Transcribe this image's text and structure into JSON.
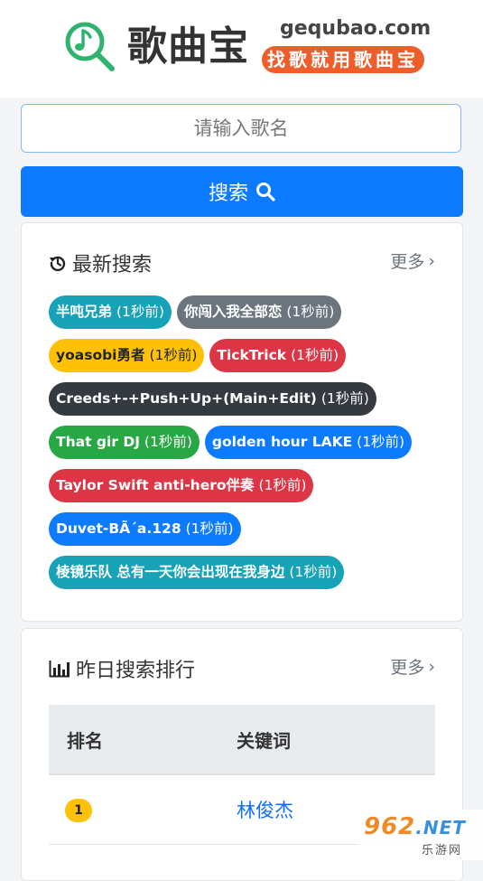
{
  "header": {
    "logo_name": "歌曲宝",
    "domain": "gequbao.com",
    "slogan": "找歌就用歌曲宝"
  },
  "search": {
    "placeholder": "请输入歌名",
    "button_label": "搜索"
  },
  "recent": {
    "title": "最新搜索",
    "more": "更多",
    "tags": [
      {
        "keyword": "半吨兄弟",
        "time": "(1秒前)",
        "color": "#17a2b8"
      },
      {
        "keyword": "你闯入我全部恋",
        "time": "(1秒前)",
        "color": "#6c757d"
      },
      {
        "keyword": "yoasobi勇者",
        "time": "(1秒前)",
        "color": "#ffc107"
      },
      {
        "keyword": "TickTrick",
        "time": "(1秒前)",
        "color": "#dc3545"
      },
      {
        "keyword": "Creeds+-+Push+Up+(Main+Edit)",
        "time": "(1秒前)",
        "color": "#343a40"
      },
      {
        "keyword": "That gir DJ",
        "time": "(1秒前)",
        "color": "#28a745"
      },
      {
        "keyword": "golden hour LAKE",
        "time": "(1秒前)",
        "color": "#0d7bff"
      },
      {
        "keyword": "Taylor Swift anti-hero伴奏",
        "time": "(1秒前)",
        "color": "#dc3545"
      },
      {
        "keyword": "Duvet-BÃ´a.128",
        "time": "(1秒前)",
        "color": "#0d7bff"
      },
      {
        "keyword": "棱镜乐队 总有一天你会出现在我身边",
        "time": "(1秒前)",
        "color": "#17a2b8"
      }
    ]
  },
  "ranking": {
    "title": "昨日搜索排行",
    "more": "更多",
    "col_rank": "排名",
    "col_keyword": "关键词",
    "rows": [
      {
        "rank": "1",
        "keyword": "林俊杰"
      }
    ]
  },
  "watermark": {
    "main": "962",
    "net": ".NET",
    "sub": "乐游网"
  },
  "colors": {
    "primary": "#0d7bff",
    "slogan": "#ef5e2a",
    "logo_green": "#2fb36e"
  }
}
